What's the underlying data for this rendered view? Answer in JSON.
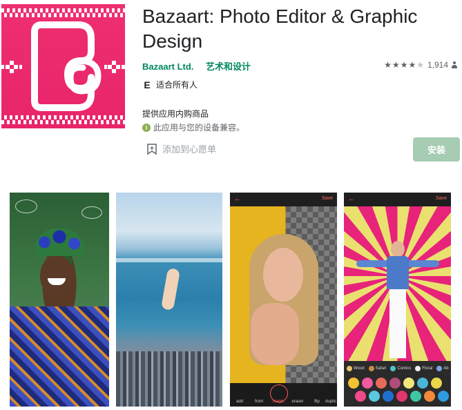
{
  "app": {
    "title": "Bazaart: Photo Editor & Graphic Design",
    "developer": "Bazaart Ltd.",
    "category": "艺术和设计",
    "content_rating_badge": "E",
    "content_rating": "适合所有人",
    "in_app_purchases": "提供应用内购商品",
    "compatibility": "此应用与您的设备兼容。",
    "wishlist_label": "添加到心愿单",
    "install_label": "安装",
    "rating_count": "1,914",
    "rating_value": 4.5,
    "brand_color": "#e8246a",
    "accent_color": "#01875f"
  },
  "screenshots": {
    "s3": {
      "back": "←",
      "save": "Save",
      "tools": [
        "add",
        "front",
        "magic",
        "eraser",
        "flip",
        "duplic"
      ]
    },
    "s4": {
      "back": "←",
      "save": "Save",
      "categories": [
        "Wood",
        "Safari",
        "Comics",
        "Floral",
        "Ab"
      ]
    }
  },
  "icons": {
    "rating_stars": "star-icon",
    "user": "user-icon",
    "wishlist": "bookmark-plus-icon",
    "info": "info-icon"
  }
}
